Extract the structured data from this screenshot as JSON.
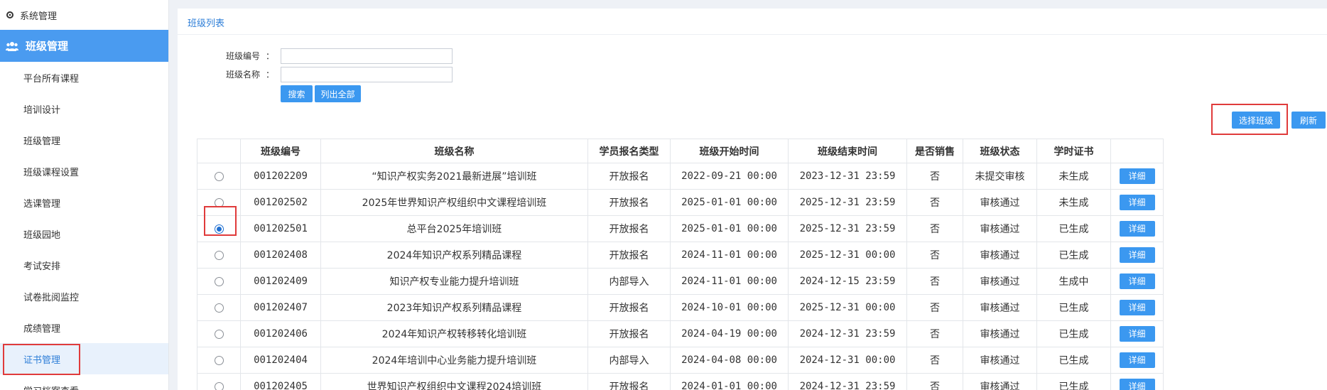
{
  "sidebar": {
    "system_label": "系统管理",
    "group_label": "班级管理",
    "items": [
      {
        "label": "平台所有课程"
      },
      {
        "label": "培训设计"
      },
      {
        "label": "班级管理"
      },
      {
        "label": "班级课程设置"
      },
      {
        "label": "选课管理"
      },
      {
        "label": "班级园地"
      },
      {
        "label": "考试安排"
      },
      {
        "label": "试卷批阅监控"
      },
      {
        "label": "成绩管理"
      },
      {
        "label": "证书管理"
      },
      {
        "label": "学习档案查看"
      }
    ]
  },
  "panel": {
    "title": "班级列表",
    "form": {
      "class_code_label": "班级编号",
      "class_name_label": "班级名称",
      "colon": "：",
      "class_code_value": "",
      "class_name_value": "",
      "search_label": "搜索",
      "list_all_label": "列出全部"
    },
    "toolbar": {
      "select_class_label": "选择班级",
      "refresh_label": "刷新"
    },
    "table": {
      "headers": [
        "",
        "班级编号",
        "班级名称",
        "学员报名类型",
        "班级开始时间",
        "班级结束时间",
        "是否销售",
        "班级状态",
        "学时证书",
        ""
      ],
      "detail_label": "详细",
      "rows": [
        {
          "selected": false,
          "code": "001202209",
          "name": "“知识产权实务2021最新进展”培训班",
          "type": "开放报名",
          "start": "2022-09-21 00:00",
          "end": "2023-12-31 23:59",
          "sale": "否",
          "status": "未提交审核",
          "cert": "未生成"
        },
        {
          "selected": false,
          "code": "001202502",
          "name": "2025年世界知识产权组织中文课程培训班",
          "type": "开放报名",
          "start": "2025-01-01 00:00",
          "end": "2025-12-31 23:59",
          "sale": "否",
          "status": "审核通过",
          "cert": "未生成"
        },
        {
          "selected": true,
          "code": "001202501",
          "name": "总平台2025年培训班",
          "type": "开放报名",
          "start": "2025-01-01 00:00",
          "end": "2025-12-31 23:59",
          "sale": "否",
          "status": "审核通过",
          "cert": "已生成"
        },
        {
          "selected": false,
          "code": "001202408",
          "name": "2024年知识产权系列精品课程",
          "type": "开放报名",
          "start": "2024-11-01 00:00",
          "end": "2025-12-31 00:00",
          "sale": "否",
          "status": "审核通过",
          "cert": "已生成"
        },
        {
          "selected": false,
          "code": "001202409",
          "name": "知识产权专业能力提升培训班",
          "type": "内部导入",
          "start": "2024-11-01 00:00",
          "end": "2024-12-15 23:59",
          "sale": "否",
          "status": "审核通过",
          "cert": "生成中"
        },
        {
          "selected": false,
          "code": "001202407",
          "name": "2023年知识产权系列精品课程",
          "type": "开放报名",
          "start": "2024-10-01 00:00",
          "end": "2025-12-31 00:00",
          "sale": "否",
          "status": "审核通过",
          "cert": "已生成"
        },
        {
          "selected": false,
          "code": "001202406",
          "name": "2024年知识产权转移转化培训班",
          "type": "开放报名",
          "start": "2024-04-19 00:00",
          "end": "2024-12-31 23:59",
          "sale": "否",
          "status": "审核通过",
          "cert": "已生成"
        },
        {
          "selected": false,
          "code": "001202404",
          "name": "2024年培训中心业务能力提升培训班",
          "type": "内部导入",
          "start": "2024-04-08 00:00",
          "end": "2024-12-31 00:00",
          "sale": "否",
          "status": "审核通过",
          "cert": "已生成"
        },
        {
          "selected": false,
          "code": "001202405",
          "name": "世界知识产权组织中文课程2024培训班",
          "type": "开放报名",
          "start": "2024-01-01 00:00",
          "end": "2024-12-31 23:59",
          "sale": "否",
          "status": "审核通过",
          "cert": "已生成"
        }
      ]
    }
  },
  "colors": {
    "accent": "#4a9bf0",
    "button": "#3b98f0",
    "highlight_box": "#e03b3b",
    "active_menu_bg": "#e8f1fc"
  }
}
